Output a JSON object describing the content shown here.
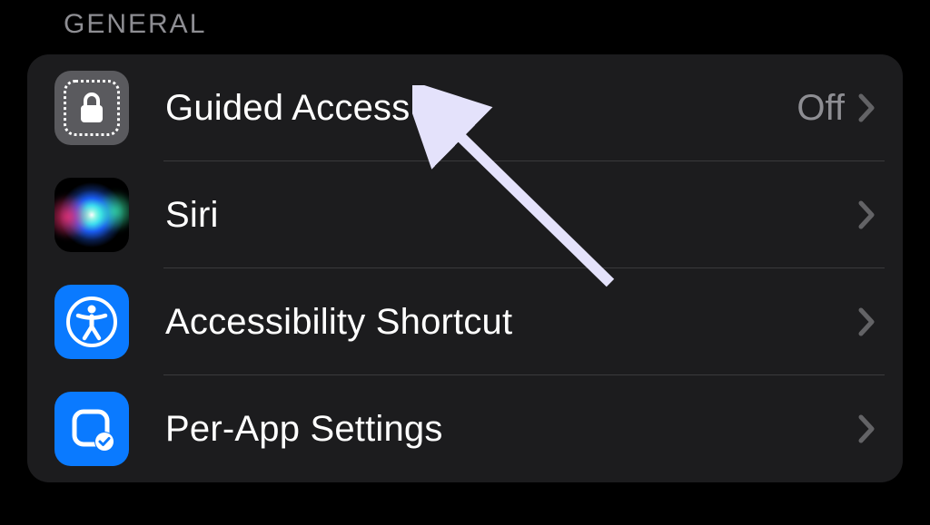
{
  "section": {
    "header": "GENERAL",
    "rows": [
      {
        "label": "Guided Access",
        "value": "Off"
      },
      {
        "label": "Siri"
      },
      {
        "label": "Accessibility Shortcut"
      },
      {
        "label": "Per-App Settings"
      }
    ]
  }
}
